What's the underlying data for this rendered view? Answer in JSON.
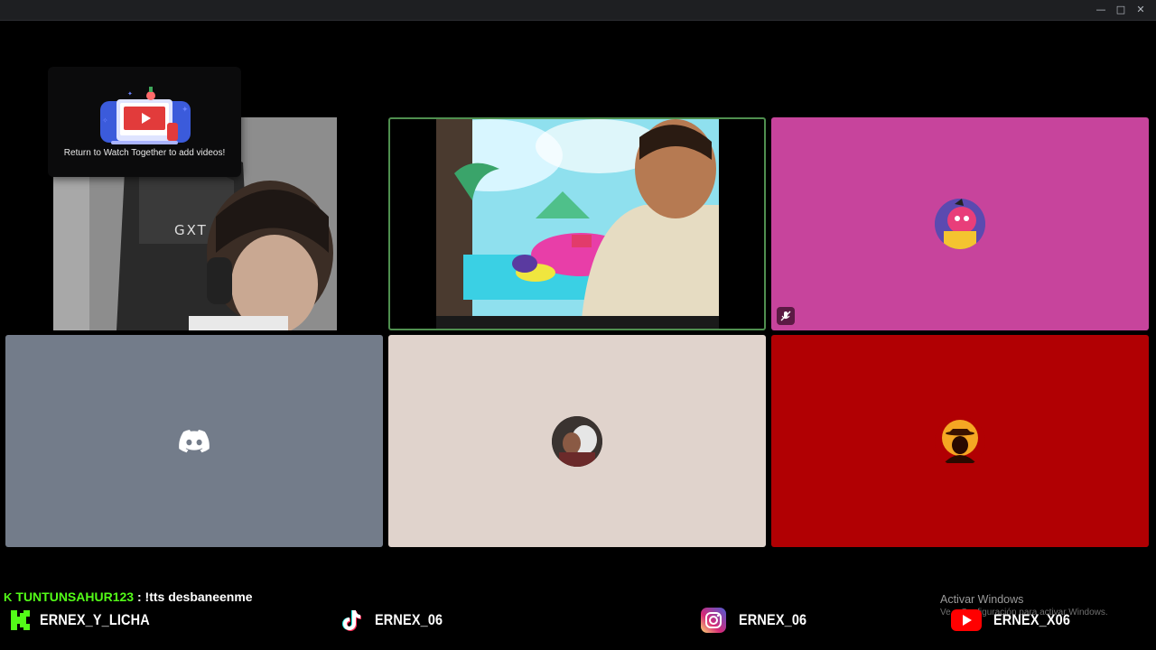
{
  "window": {
    "controls": [
      "minimize",
      "maximize",
      "close"
    ]
  },
  "watch_together_popup": {
    "message": "Return to Watch Together to add videos!"
  },
  "tiles": [
    {
      "id": "cam-1",
      "type": "camera",
      "overlay_text": "GXT"
    },
    {
      "id": "cam-2",
      "type": "camera",
      "speaking": true
    },
    {
      "id": "avatar-pink",
      "type": "avatar",
      "bg": "#c7449c",
      "muted": true,
      "icon": "cartoon-avatar-icon"
    },
    {
      "id": "avatar-discord",
      "type": "avatar",
      "bg": "#737c8a",
      "icon": "discord-logo-icon"
    },
    {
      "id": "avatar-photo",
      "type": "avatar",
      "bg": "#e0d3cc",
      "icon": "user-photo-avatar"
    },
    {
      "id": "avatar-red",
      "type": "avatar",
      "bg": "#b10003",
      "icon": "sunset-cowboy-avatar"
    }
  ],
  "chat": {
    "username": "TUNTUNSAHUR123",
    "separator": " : ",
    "message": "!tts desbaneenme"
  },
  "socials": [
    {
      "platform": "kick",
      "handle": "ERNEX_Y_LICHA",
      "color": "#53fc18"
    },
    {
      "platform": "tiktok",
      "handle": "ERNEX_06"
    },
    {
      "platform": "instagram",
      "handle": "ERNEX_06"
    },
    {
      "platform": "youtube",
      "handle": "ERNEX_X06",
      "color": "#ff0000"
    }
  ],
  "windows_activation": {
    "title": "Activar Windows",
    "subtitle": "Ve a Configuración para activar Windows."
  }
}
